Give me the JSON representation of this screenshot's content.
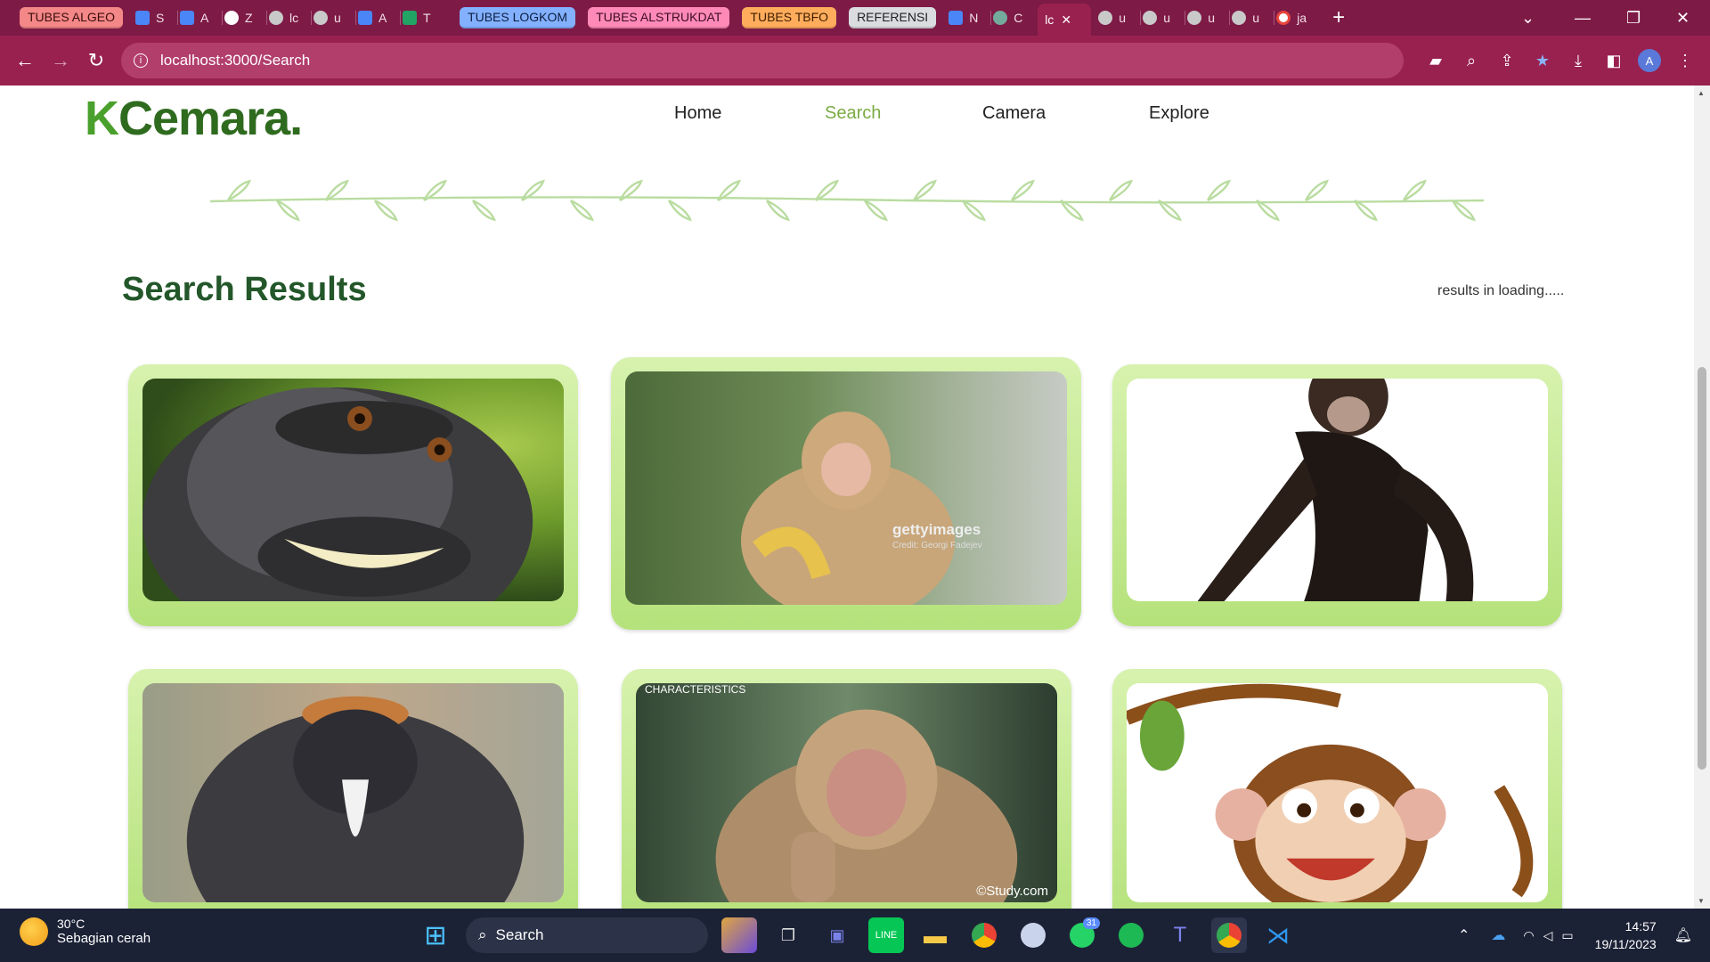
{
  "browser": {
    "tab_groups": [
      {
        "label": "TUBES ALGEO",
        "color": "#f48787",
        "text": "#3a0d0d"
      },
      {
        "label": "TUBES LOGKOM",
        "color": "#83b1ff",
        "text": "#0d1e3f"
      },
      {
        "label": "TUBES ALSTRUKDAT",
        "color": "#ff8ab7",
        "text": "#3e0b22"
      },
      {
        "label": "TUBES TBFO",
        "color": "#ffad5c",
        "text": "#3d1d00"
      },
      {
        "label": "REFERENSI",
        "color": "#dadce0",
        "text": "#202124"
      }
    ],
    "mini_tabs_a": [
      {
        "letter": "S",
        "icon": "docs-icon"
      },
      {
        "letter": "A",
        "icon": "docs-icon"
      },
      {
        "letter": "Z",
        "icon": "github-icon"
      },
      {
        "letter": "lc",
        "icon": "globe-icon"
      },
      {
        "letter": "u",
        "icon": "globe-icon"
      },
      {
        "letter": "A",
        "icon": "docs-icon"
      },
      {
        "letter": "T",
        "icon": "sheets-icon"
      }
    ],
    "mini_tabs_b": [
      {
        "letter": "N",
        "icon": "docs-icon"
      },
      {
        "letter": "C",
        "icon": "chatgpt-icon"
      }
    ],
    "active_tab": {
      "letter": "lc",
      "close": "✕"
    },
    "mini_tabs_c": [
      {
        "letter": "u",
        "icon": "globe-icon"
      },
      {
        "letter": "u",
        "icon": "globe-icon"
      },
      {
        "letter": "u",
        "icon": "globe-icon"
      },
      {
        "letter": "u",
        "icon": "globe-icon"
      },
      {
        "letter": "ja",
        "icon": "google-icon"
      }
    ],
    "new_tab": "+",
    "url": "localhost:3000/Search",
    "profile_initial": "A"
  },
  "page": {
    "logo_k": "K",
    "logo_rest": "Cemara.",
    "nav": [
      "Home",
      "Search",
      "Camera",
      "Explore"
    ],
    "active_nav": "Search",
    "results_title": "Search Results",
    "loading_text": "results in loading.....",
    "cards": [
      {
        "alt": "macaque-selfie",
        "caption": ""
      },
      {
        "alt": "monkey-eating-banana",
        "caption": "gettyimages",
        "credit": "Credit: Georgi Fadejev"
      },
      {
        "alt": "chimpanzee",
        "caption": ""
      },
      {
        "alt": "de-brazza-monkey",
        "caption": ""
      },
      {
        "alt": "macaque-thumbs-up",
        "caption": "CHARACTERISTICS",
        "credit": "©Study.com"
      },
      {
        "alt": "cartoon-monkey",
        "caption": ""
      }
    ]
  },
  "taskbar": {
    "temperature": "30°C",
    "weather": "Sebagian cerah",
    "search_label": "Search",
    "whatsapp_badge": "31",
    "time": "14:57",
    "date": "19/11/2023"
  }
}
